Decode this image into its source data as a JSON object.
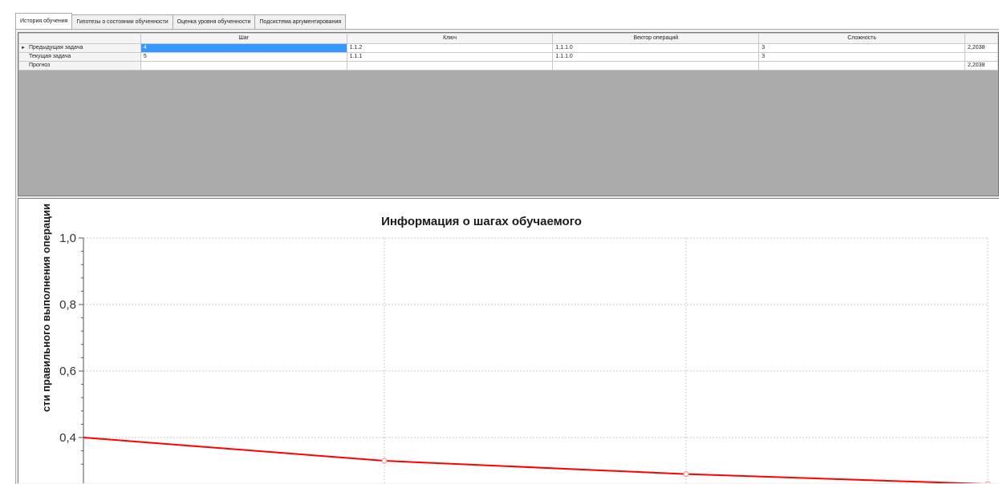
{
  "tabs": [
    {
      "label": "История обучения",
      "active": true
    },
    {
      "label": "Гипотезы о состоянии обученности",
      "active": false
    },
    {
      "label": "Оценка уровня обученности",
      "active": false
    },
    {
      "label": "Подсистема аргументирования",
      "active": false
    }
  ],
  "grid": {
    "columns": [
      "",
      "Шаг",
      "Ключ",
      "Вектор операций",
      "Сложность",
      ""
    ],
    "rows": [
      {
        "label": "Предыдущая задача",
        "current": true,
        "cells": [
          "4",
          "1.1.2",
          "1.1.1.0",
          "3",
          "2,2038"
        ]
      },
      {
        "label": "Текущая задача",
        "current": false,
        "cells": [
          "5",
          "1.1.1",
          "1.1.1.0",
          "3",
          ""
        ]
      },
      {
        "label": "Прогноз",
        "current": false,
        "cells": [
          "",
          "",
          "",
          "",
          "2,2038"
        ]
      }
    ]
  },
  "chart": {
    "title": "Информация о шагах обучаемого",
    "ylabel": "сти правильного выполнения операции",
    "yticks": [
      "1,0",
      "0,8",
      "0,6",
      "0,4"
    ]
  },
  "chart_data": {
    "type": "line",
    "title": "Информация о шагах обучаемого",
    "ylabel": "сти правильного выполнения операции",
    "xlabel": "",
    "ylim": [
      0.3,
      1.0
    ],
    "grid": true,
    "series": [
      {
        "x": [
          1,
          2,
          3,
          4
        ],
        "values": [
          0.4,
          0.33,
          0.29,
          0.26
        ],
        "color": "#ff0000"
      }
    ]
  },
  "colors": {
    "selection": "#3399ff",
    "line": "#ff0000"
  }
}
